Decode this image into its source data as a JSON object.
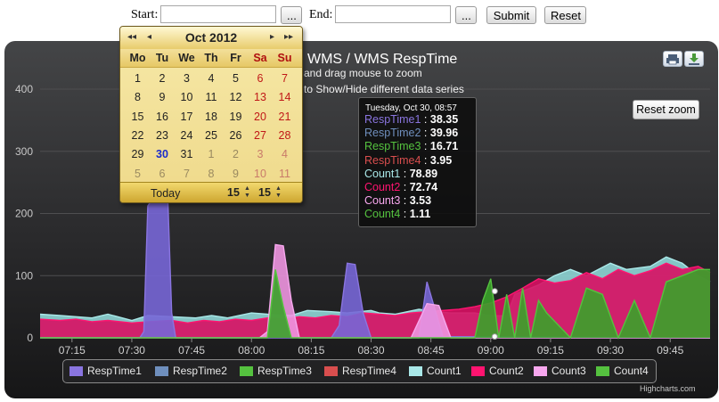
{
  "toolbar": {
    "start_label": "Start:",
    "start_value": "",
    "start_browse": "...",
    "end_label": "End:",
    "end_value": "",
    "end_browse": "...",
    "submit_label": "Submit",
    "reset_label": "Reset"
  },
  "calendar": {
    "month_year": "Oct 2012",
    "nav": {
      "prev_year": "◂◂",
      "prev_month": "◂",
      "next_month": "▸",
      "next_year": "▸▸"
    },
    "weekdays": [
      "Mo",
      "Tu",
      "We",
      "Th",
      "Fr",
      "Sa",
      "Su"
    ],
    "weeks": [
      [
        "1",
        "2",
        "3",
        "4",
        "5",
        "6",
        "7"
      ],
      [
        "8",
        "9",
        "10",
        "11",
        "12",
        "13",
        "14"
      ],
      [
        "15",
        "16",
        "17",
        "18",
        "19",
        "20",
        "21"
      ],
      [
        "22",
        "23",
        "24",
        "25",
        "26",
        "27",
        "28"
      ],
      [
        "29",
        "30",
        "31",
        "1",
        "2",
        "3",
        "4"
      ],
      [
        "5",
        "6",
        "7",
        "8",
        "9",
        "10",
        "11"
      ]
    ],
    "today_label": "Today",
    "hour": "15",
    "minute": "15",
    "selected_day": "30"
  },
  "chart": {
    "title": "WMS / WMS RespTime",
    "subtitle_line1": "and drag mouse to  zoom",
    "subtitle_line2": "to Show/Hide different data series",
    "reset_zoom_label": "Reset zoom",
    "credits": "Highcharts.com",
    "print_icon": "printer-icon",
    "export_icon": "download-icon"
  },
  "tooltip": {
    "header": "Tuesday, Oct 30, 08:57",
    "rows": [
      {
        "name": "RespTime1",
        "value": "38.35",
        "color": "#8a75e0"
      },
      {
        "name": "RespTime2",
        "value": "39.96",
        "color": "#6f8fbd"
      },
      {
        "name": "RespTime3",
        "value": "16.71",
        "color": "#55c23f"
      },
      {
        "name": "RespTime4",
        "value": "3.95",
        "color": "#d94e4e"
      },
      {
        "name": "Count1",
        "value": "78.89",
        "color": "#a9e8e8"
      },
      {
        "name": "Count2",
        "value": "72.74",
        "color": "#ff1470"
      },
      {
        "name": "Count3",
        "value": "3.53",
        "color": "#f7a7ee"
      },
      {
        "name": "Count4",
        "value": "1.11",
        "color": "#55c23f"
      }
    ]
  },
  "chart_data": {
    "type": "area",
    "title": "WMS / WMS RespTime",
    "ylim": [
      0,
      400
    ],
    "y_ticks": [
      "0",
      "100",
      "200",
      "300",
      "400"
    ],
    "x_ticks": [
      "07:15",
      "07:30",
      "07:45",
      "08:00",
      "08:15",
      "08:30",
      "08:45",
      "09:00",
      "09:15",
      "09:30",
      "09:45"
    ],
    "x_start_min": 427,
    "x_end_min": 595,
    "grid": true,
    "legend_placement": "bottom",
    "series": [
      {
        "name": "Count1",
        "color": "#a9e8e8",
        "fill": "#8fd6d6",
        "points": [
          [
            427,
            38
          ],
          [
            432,
            36
          ],
          [
            440,
            32
          ],
          [
            444,
            38
          ],
          [
            450,
            28
          ],
          [
            454,
            36
          ],
          [
            460,
            34
          ],
          [
            466,
            32
          ],
          [
            470,
            36
          ],
          [
            474,
            32
          ],
          [
            480,
            40
          ],
          [
            484,
            38
          ],
          [
            490,
            36
          ],
          [
            494,
            44
          ],
          [
            500,
            42
          ],
          [
            504,
            40
          ],
          [
            510,
            44
          ],
          [
            512,
            40
          ],
          [
            516,
            38
          ],
          [
            522,
            46
          ],
          [
            526,
            42
          ],
          [
            530,
            40
          ],
          [
            536,
            40
          ],
          [
            540,
            36
          ],
          [
            544,
            35
          ],
          [
            546,
            70
          ],
          [
            552,
            85
          ],
          [
            556,
            100
          ],
          [
            560,
            110
          ],
          [
            564,
            100
          ],
          [
            570,
            120
          ],
          [
            574,
            110
          ],
          [
            580,
            115
          ],
          [
            584,
            130
          ],
          [
            588,
            120
          ],
          [
            592,
            100
          ],
          [
            595,
            90
          ]
        ]
      },
      {
        "name": "Count2",
        "color": "#ff1470",
        "fill": "#d80f63",
        "points": [
          [
            427,
            30
          ],
          [
            432,
            28
          ],
          [
            436,
            30
          ],
          [
            440,
            26
          ],
          [
            444,
            28
          ],
          [
            450,
            24
          ],
          [
            454,
            26
          ],
          [
            460,
            28
          ],
          [
            464,
            24
          ],
          [
            468,
            28
          ],
          [
            472,
            26
          ],
          [
            476,
            30
          ],
          [
            480,
            28
          ],
          [
            484,
            32
          ],
          [
            488,
            30
          ],
          [
            492,
            34
          ],
          [
            496,
            32
          ],
          [
            500,
            36
          ],
          [
            504,
            34
          ],
          [
            508,
            40
          ],
          [
            512,
            38
          ],
          [
            516,
            36
          ],
          [
            520,
            40
          ],
          [
            524,
            42
          ],
          [
            528,
            44
          ],
          [
            532,
            46
          ],
          [
            536,
            50
          ],
          [
            540,
            56
          ],
          [
            544,
            66
          ],
          [
            548,
            80
          ],
          [
            552,
            95
          ],
          [
            556,
            88
          ],
          [
            560,
            92
          ],
          [
            564,
            105
          ],
          [
            568,
            95
          ],
          [
            572,
            110
          ],
          [
            576,
            100
          ],
          [
            580,
            108
          ],
          [
            584,
            120
          ],
          [
            588,
            110
          ],
          [
            592,
            115
          ],
          [
            595,
            105
          ]
        ]
      },
      {
        "name": "RespTime1",
        "color": "#8a75e0",
        "fill": "#7766d6",
        "points": [
          [
            427,
            0
          ],
          [
            452,
            0
          ],
          [
            453,
            10
          ],
          [
            454,
            212
          ],
          [
            456,
            232
          ],
          [
            459,
            230
          ],
          [
            460,
            40
          ],
          [
            461,
            0
          ],
          [
            500,
            0
          ],
          [
            502,
            20
          ],
          [
            504,
            120
          ],
          [
            506,
            118
          ],
          [
            508,
            40
          ],
          [
            510,
            0
          ],
          [
            522,
            0
          ],
          [
            524,
            90
          ],
          [
            528,
            2
          ],
          [
            595,
            0
          ]
        ]
      },
      {
        "name": "Count3",
        "color": "#f7a7ee",
        "fill": "#ee95e0",
        "points": [
          [
            427,
            0
          ],
          [
            482,
            0
          ],
          [
            484,
            10
          ],
          [
            486,
            150
          ],
          [
            488,
            148
          ],
          [
            490,
            60
          ],
          [
            492,
            0
          ],
          [
            494,
            0
          ],
          [
            520,
            0
          ],
          [
            524,
            55
          ],
          [
            527,
            52
          ],
          [
            530,
            0
          ],
          [
            595,
            0
          ]
        ]
      },
      {
        "name": "Count4",
        "color": "#55c23f",
        "fill": "#3aa22a",
        "points": [
          [
            427,
            0
          ],
          [
            484,
            0
          ],
          [
            486,
            110
          ],
          [
            488,
            50
          ],
          [
            490,
            0
          ],
          [
            536,
            0
          ],
          [
            538,
            60
          ],
          [
            540,
            95
          ],
          [
            542,
            0
          ],
          [
            544,
            70
          ],
          [
            546,
            0
          ],
          [
            548,
            80
          ],
          [
            550,
            0
          ],
          [
            552,
            60
          ],
          [
            554,
            40
          ],
          [
            560,
            0
          ],
          [
            564,
            80
          ],
          [
            568,
            70
          ],
          [
            572,
            0
          ],
          [
            576,
            60
          ],
          [
            580,
            0
          ],
          [
            584,
            90
          ],
          [
            588,
            100
          ],
          [
            592,
            110
          ],
          [
            595,
            110
          ]
        ]
      }
    ]
  },
  "legend": [
    {
      "name": "RespTime1",
      "color": "#8a75e0"
    },
    {
      "name": "RespTime2",
      "color": "#6f8fbd"
    },
    {
      "name": "RespTime3",
      "color": "#55c23f"
    },
    {
      "name": "RespTime4",
      "color": "#d94e4e"
    },
    {
      "name": "Count1",
      "color": "#a9e8e8"
    },
    {
      "name": "Count2",
      "color": "#ff1470"
    },
    {
      "name": "Count3",
      "color": "#f7a7ee"
    },
    {
      "name": "Count4",
      "color": "#55c23f"
    }
  ]
}
